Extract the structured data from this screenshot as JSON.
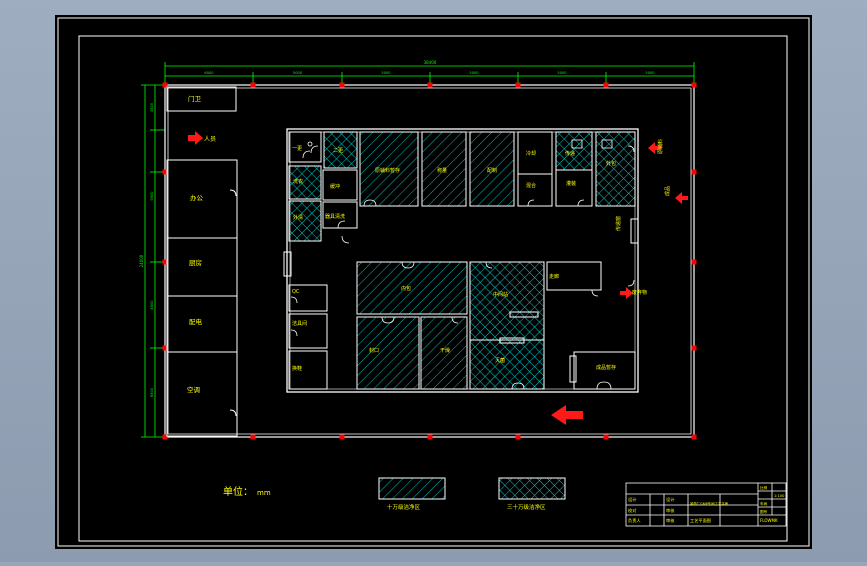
{
  "drawing": {
    "overall_dimension": "38400",
    "top_dimensions": [
      "6000",
      "5000",
      "5000",
      "5000",
      "5000",
      "5000",
      "5000"
    ],
    "left_dimensions": [
      "3500",
      "9500",
      "4500",
      "6500"
    ],
    "left_overall_dimension": "24000"
  },
  "exterior": [
    {
      "id": "guard",
      "label": "门卫"
    },
    {
      "id": "office",
      "label": "办公"
    },
    {
      "id": "kitchen",
      "label": "厨房"
    },
    {
      "id": "power",
      "label": "配电"
    },
    {
      "id": "hvac",
      "label": "空调"
    }
  ],
  "flow_labels": {
    "staff_in": "人员",
    "material_in": "原辅料",
    "product_out": "成品",
    "waste_out": "废弃物"
  },
  "interior_labels": {
    "r_change1": "一更",
    "r_buffer": "缓冲",
    "r_change2": "二更",
    "r_wash": "洗衣",
    "r_storage": "原辅料暂存",
    "r_weigh": "称量",
    "r_prep": "配制",
    "r_cool": "冷却",
    "r_mix": "混合",
    "r_pass_a": "传递",
    "r_fill": "灌装",
    "r_pack": "外包",
    "r_outer": "外清",
    "r_tools": "器具清洗",
    "r_qc": "QC",
    "r_cleantool": "洁具间",
    "r_shoes": "换鞋",
    "r_inner": "内包",
    "r_seal": "封口",
    "r_dry": "干燥",
    "r_semi": "中间站",
    "r_sterile": "灭菌",
    "r_corridor_label": "走廊",
    "r_finished": "成品暂存",
    "r_pass": "传递窗"
  },
  "legend": {
    "unit_label": "单位：",
    "unit_value": "mm",
    "items": [
      {
        "label": "十万级洁净区"
      },
      {
        "label": "三十万级洁净区"
      }
    ]
  },
  "title_block": {
    "rows": [
      [
        "设计",
        "",
        "",
        ""
      ],
      [
        "校对",
        "",
        "车间",
        "比例"
      ],
      [
        "审核",
        "",
        "工艺平面",
        "1:100"
      ],
      [
        "负责人",
        "",
        "",
        "图号"
      ]
    ],
    "project_name": "某药厂GMP车间工艺平面",
    "drawing_name": "工艺平面图",
    "drawing_no": "FLOWMK"
  },
  "colors": {
    "frame_bg": "#000000",
    "line": "#ffffff",
    "text": "#ffff00",
    "dimension": "#00ff00",
    "column": "#ff0000",
    "arrow": "#ff1a1a",
    "hatch_100k": "#00c8c8",
    "hatch_300k": "#00d0d0"
  }
}
